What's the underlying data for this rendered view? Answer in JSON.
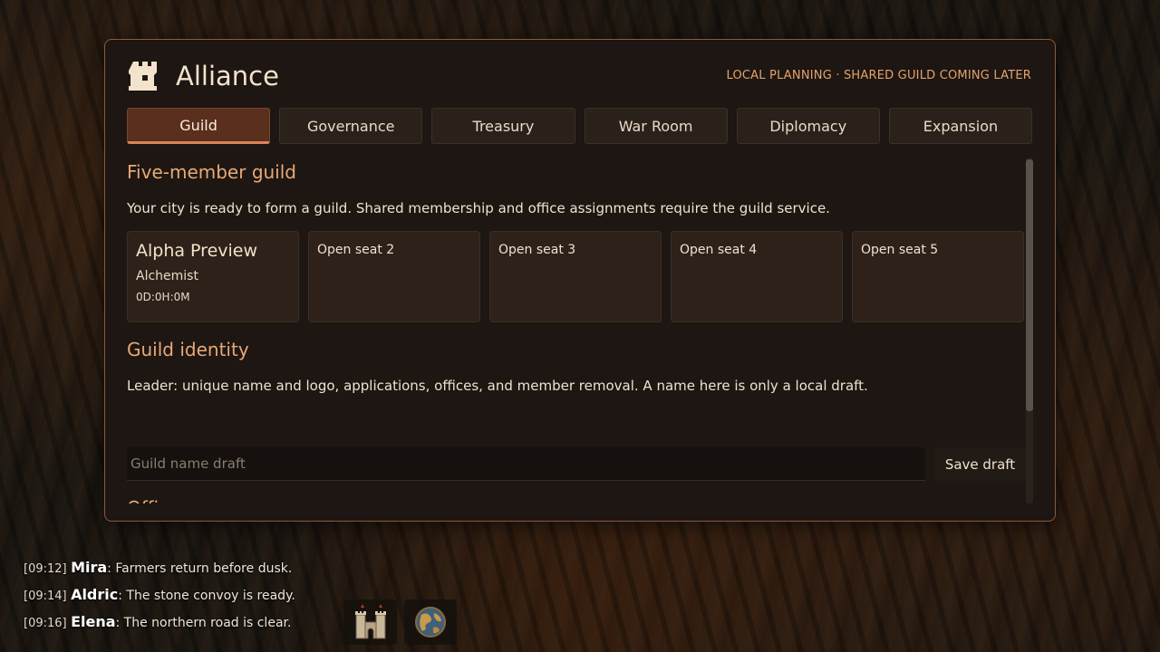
{
  "panel": {
    "title": "Alliance",
    "note": "LOCAL PLANNING · SHARED GUILD COMING LATER",
    "icon": "tower-icon"
  },
  "tabs": [
    {
      "label": "Guild",
      "active": true
    },
    {
      "label": "Governance",
      "active": false
    },
    {
      "label": "Treasury",
      "active": false
    },
    {
      "label": "War Room",
      "active": false
    },
    {
      "label": "Diplomacy",
      "active": false
    },
    {
      "label": "Expansion",
      "active": false
    }
  ],
  "guild": {
    "title": "Five-member guild",
    "description": "Your city is ready to form a guild. Shared membership and office assignments require the guild service.",
    "seats": [
      {
        "name": "Alpha Preview",
        "role": "Alchemist",
        "timer": "0D:0H:0M"
      },
      {
        "name": "Open seat 2"
      },
      {
        "name": "Open seat 3"
      },
      {
        "name": "Open seat 4"
      },
      {
        "name": "Open seat 5"
      }
    ]
  },
  "identity": {
    "title": "Guild identity",
    "description": "Leader: unique name and logo, applications, offices, and member removal. A name here is only a local draft.",
    "input_placeholder": "Guild name draft",
    "input_value": "",
    "save_label": "Save draft"
  },
  "offices": {
    "title": "Offices"
  },
  "chat": [
    {
      "time": "[09:12]",
      "name": "Mira",
      "message": ": Farmers return before dusk."
    },
    {
      "time": "[09:14]",
      "name": "Aldric",
      "message": ": The stone convoy is ready."
    },
    {
      "time": "[09:16]",
      "name": "Elena",
      "message": ": The northern road is clear."
    }
  ],
  "dock": [
    {
      "icon": "castle-gate-icon"
    },
    {
      "icon": "globe-icon"
    }
  ],
  "colors": {
    "accent": "#e7a977",
    "panel_border": "#8a5a3c",
    "active_tab": "#5a2f1e",
    "text": "#efe2cf"
  }
}
